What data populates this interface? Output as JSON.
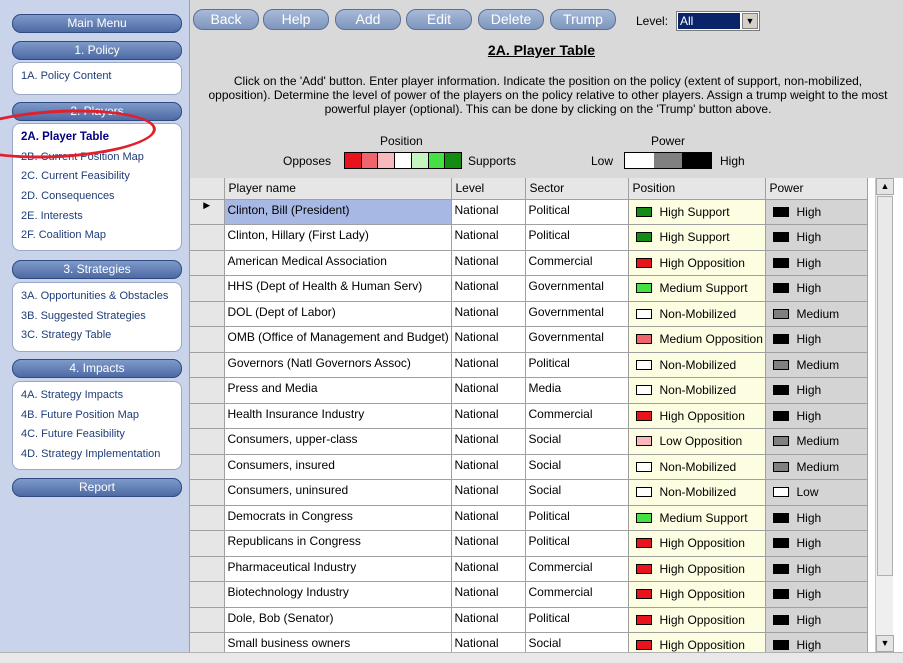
{
  "sidebar": {
    "main_menu": "Main Menu",
    "sections": [
      {
        "title": "1. Policy",
        "items": [
          "1A. Policy Content"
        ]
      },
      {
        "title": "2. Players",
        "items": [
          "2A. Player Table",
          "2B. Current Position Map",
          "2C. Current Feasibility",
          "2D. Consequences",
          "2E. Interests",
          "2F. Coalition Map"
        ]
      },
      {
        "title": "3. Strategies",
        "items": [
          "3A. Opportunities & Obstacles",
          "3B. Suggested Strategies",
          "3C. Strategy Table"
        ]
      },
      {
        "title": "4. Impacts",
        "items": [
          "4A. Strategy Impacts",
          "4B. Future Position Map",
          "4C. Future Feasibility",
          "4D. Strategy Implementation"
        ]
      }
    ],
    "report": "Report",
    "active_item": "2A. Player Table"
  },
  "toolbar": {
    "buttons": [
      "Back",
      "Help",
      "Add",
      "Edit",
      "Delete",
      "Trump"
    ],
    "level_label": "Level:",
    "level_value": "All"
  },
  "header": {
    "title": "2A. Player Table",
    "instructions": "Click on the 'Add' button. Enter player information.  Indicate the position on the policy (extent of support, non-mobilized, opposition).  Determine the level of power of the players on the policy relative to other players.  Assign a trump weight to the most powerful player (optional). This can be done by clicking on the 'Trump' button above."
  },
  "legend": {
    "position_label": "Position",
    "opposes_label": "Opposes",
    "supports_label": "Supports",
    "position_colors": [
      "#e8141c",
      "#f0646c",
      "#f8b8bc",
      "#ffffff",
      "#c4f4c0",
      "#44e044",
      "#148c14"
    ],
    "power_label": "Power",
    "low_label": "Low",
    "high_label": "High",
    "power_colors": [
      "#ffffff",
      "#808080",
      "#000000"
    ]
  },
  "table": {
    "columns": [
      "Player name",
      "Level",
      "Sector",
      "Position",
      "Power"
    ],
    "rows": [
      {
        "name": "Clinton, Bill (President)",
        "level": "National",
        "sector": "Political",
        "position": "High Support",
        "position_color": "#148c14",
        "power": "High",
        "power_color": "#000000"
      },
      {
        "name": "Clinton, Hillary (First Lady)",
        "level": "National",
        "sector": "Political",
        "position": "High Support",
        "position_color": "#148c14",
        "power": "High",
        "power_color": "#000000"
      },
      {
        "name": "American Medical Association",
        "level": "National",
        "sector": "Commercial",
        "position": "High Opposition",
        "position_color": "#e8141c",
        "power": "High",
        "power_color": "#000000"
      },
      {
        "name": "HHS (Dept of Health & Human Serv)",
        "level": "National",
        "sector": "Governmental",
        "position": "Medium Support",
        "position_color": "#44e044",
        "power": "High",
        "power_color": "#000000"
      },
      {
        "name": "DOL (Dept of Labor)",
        "level": "National",
        "sector": "Governmental",
        "position": "Non-Mobilized",
        "position_color": "#ffffff",
        "power": "Medium",
        "power_color": "#808080"
      },
      {
        "name": "OMB (Office of Management and Budget)",
        "level": "National",
        "sector": "Governmental",
        "position": "Medium Opposition",
        "position_color": "#f0646c",
        "power": "High",
        "power_color": "#000000"
      },
      {
        "name": "Governors (Natl Governors Assoc)",
        "level": "National",
        "sector": "Political",
        "position": "Non-Mobilized",
        "position_color": "#ffffff",
        "power": "Medium",
        "power_color": "#808080"
      },
      {
        "name": "Press and Media",
        "level": "National",
        "sector": "Media",
        "position": "Non-Mobilized",
        "position_color": "#ffffff",
        "power": "High",
        "power_color": "#000000"
      },
      {
        "name": "Health Insurance Industry",
        "level": "National",
        "sector": "Commercial",
        "position": "High Opposition",
        "position_color": "#e8141c",
        "power": "High",
        "power_color": "#000000"
      },
      {
        "name": "Consumers, upper-class",
        "level": "National",
        "sector": "Social",
        "position": "Low Opposition",
        "position_color": "#f8b8bc",
        "power": "Medium",
        "power_color": "#808080"
      },
      {
        "name": "Consumers, insured",
        "level": "National",
        "sector": "Social",
        "position": "Non-Mobilized",
        "position_color": "#ffffff",
        "power": "Medium",
        "power_color": "#808080"
      },
      {
        "name": "Consumers, uninsured",
        "level": "National",
        "sector": "Social",
        "position": "Non-Mobilized",
        "position_color": "#ffffff",
        "power": "Low",
        "power_color": "#ffffff"
      },
      {
        "name": "Democrats in Congress",
        "level": "National",
        "sector": "Political",
        "position": "Medium Support",
        "position_color": "#44e044",
        "power": "High",
        "power_color": "#000000"
      },
      {
        "name": "Republicans in Congress",
        "level": "National",
        "sector": "Political",
        "position": "High Opposition",
        "position_color": "#e8141c",
        "power": "High",
        "power_color": "#000000"
      },
      {
        "name": "Pharmaceutical Industry",
        "level": "National",
        "sector": "Commercial",
        "position": "High Opposition",
        "position_color": "#e8141c",
        "power": "High",
        "power_color": "#000000"
      },
      {
        "name": "Biotechnology Industry",
        "level": "National",
        "sector": "Commercial",
        "position": "High Opposition",
        "position_color": "#e8141c",
        "power": "High",
        "power_color": "#000000"
      },
      {
        "name": "Dole, Bob (Senator)",
        "level": "National",
        "sector": "Political",
        "position": "High Opposition",
        "position_color": "#e8141c",
        "power": "High",
        "power_color": "#000000"
      },
      {
        "name": "Small business owners",
        "level": "National",
        "sector": "Social",
        "position": "High Opposition",
        "position_color": "#e8141c",
        "power": "High",
        "power_color": "#000000"
      }
    ],
    "current_row": 0,
    "current_marker": "▶"
  }
}
